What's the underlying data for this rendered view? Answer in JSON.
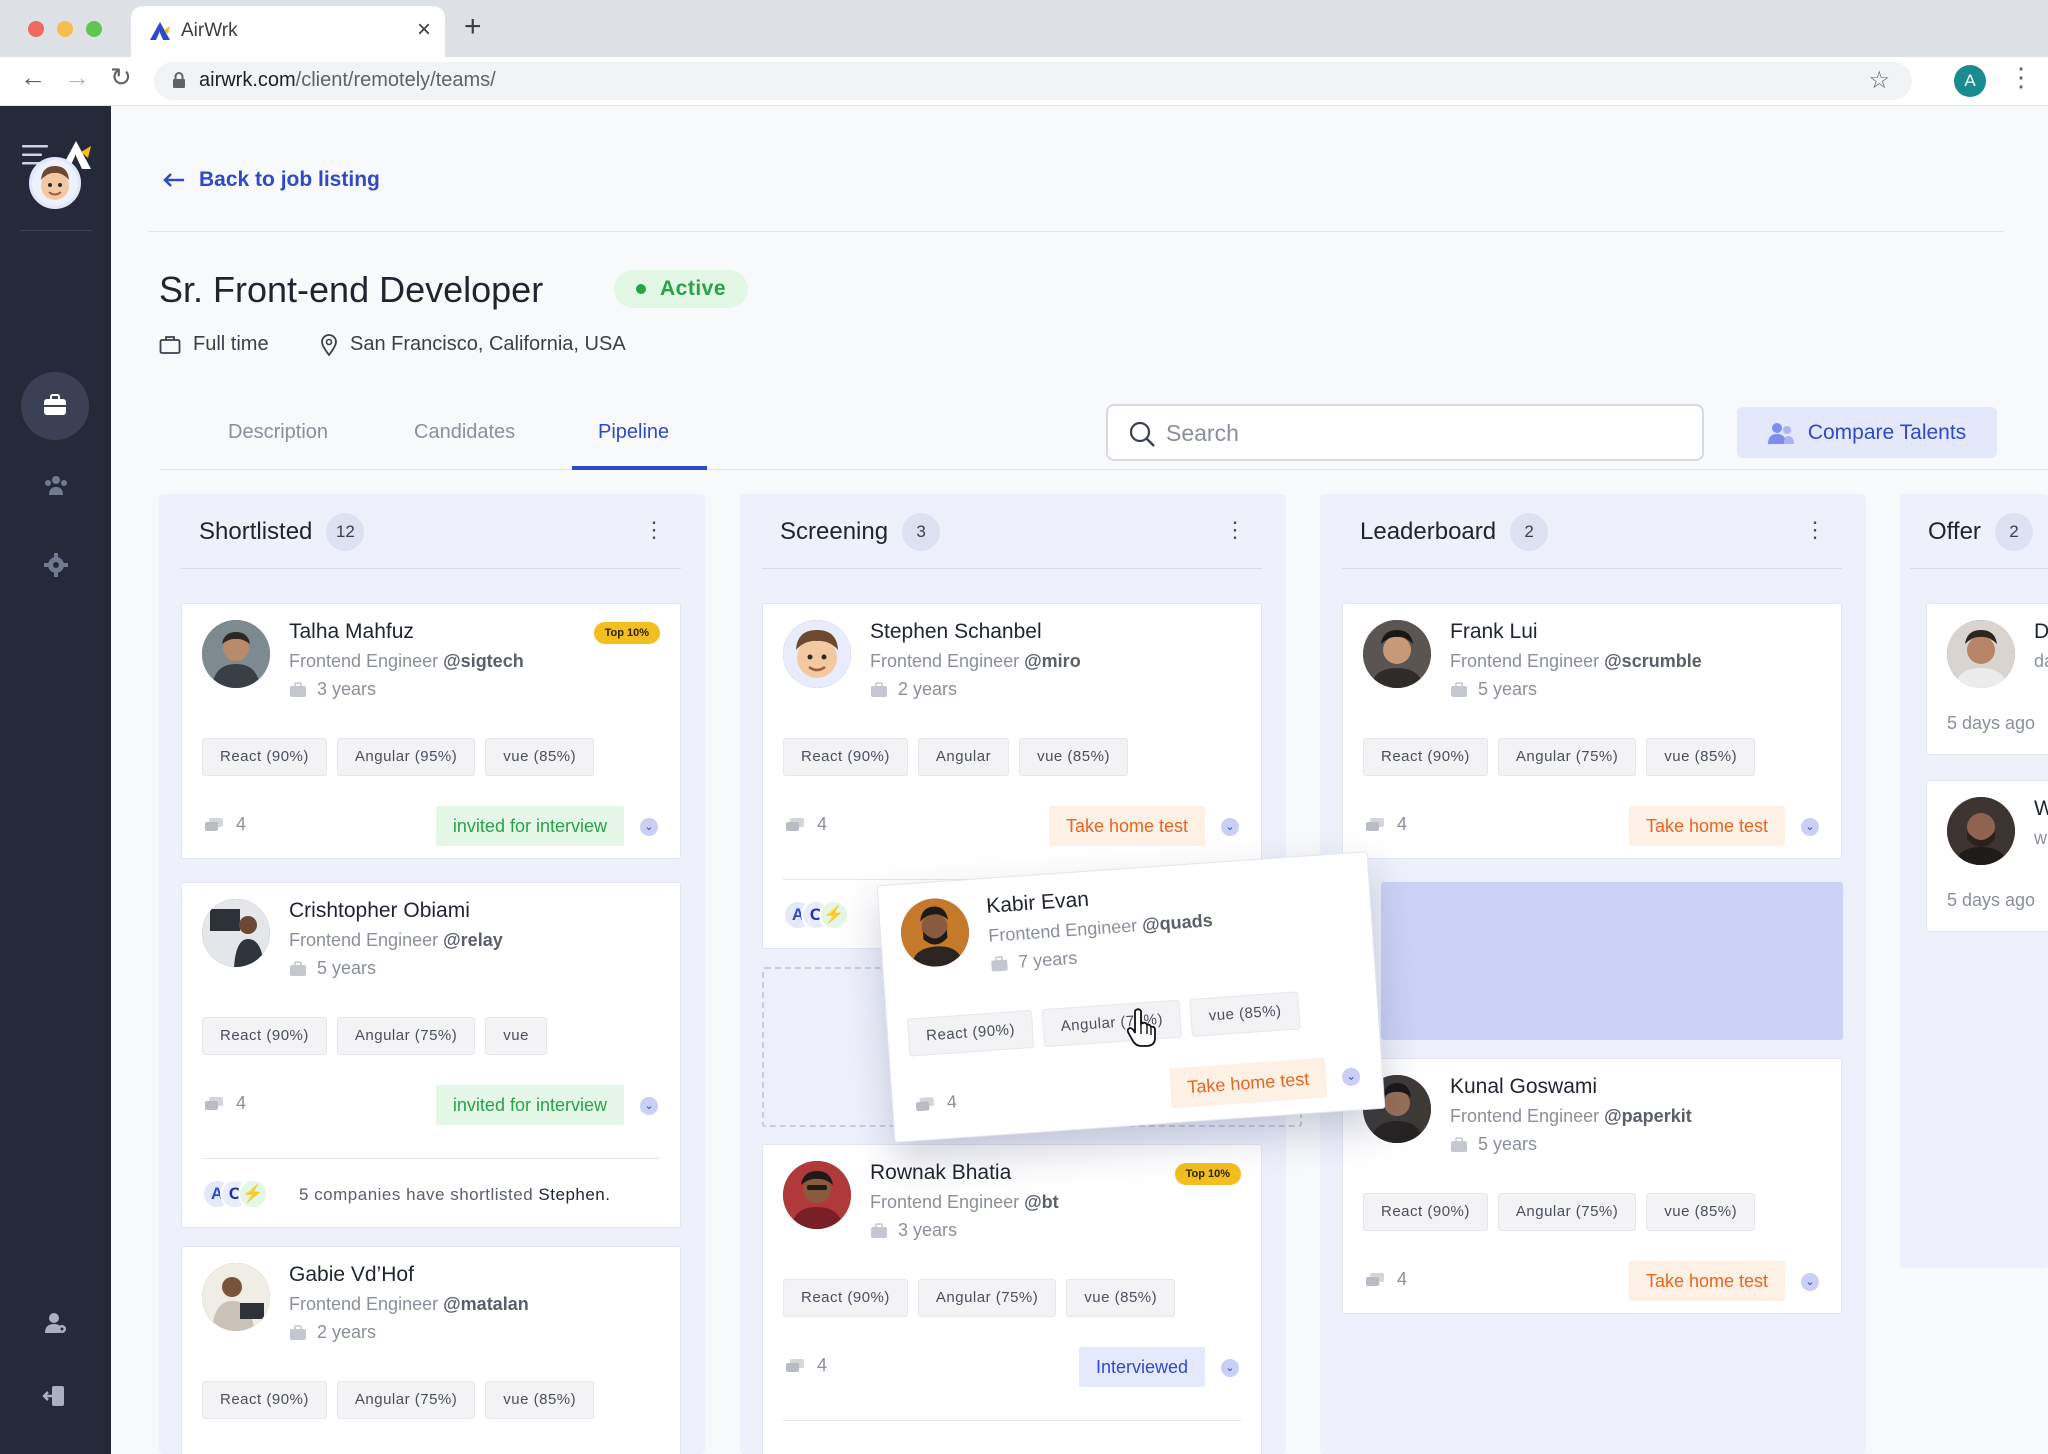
{
  "browser": {
    "tab_title": "AirWrk",
    "url_host": "airwrk.com",
    "url_path": "/client/remotely/teams/",
    "profile_initial": "A"
  },
  "page": {
    "back_label": "Back to job listing",
    "job_title": "Sr. Front-end Developer",
    "status": "Active",
    "employment_type": "Full time",
    "location": "San Francisco, California, USA"
  },
  "tabs": [
    {
      "label": "Description"
    },
    {
      "label": "Candidates"
    },
    {
      "label": "Pipeline",
      "active": true
    }
  ],
  "search": {
    "placeholder": "Search"
  },
  "compare_label": "Compare Talents",
  "columns": [
    {
      "name": "Shortlisted",
      "count": "12"
    },
    {
      "name": "Screening",
      "count": "3"
    },
    {
      "name": "Leaderboard",
      "count": "2"
    },
    {
      "name": "Offer",
      "count": "2"
    }
  ],
  "cards": {
    "talha": {
      "name": "Talha Mahfuz",
      "role": "Frontend Engineer",
      "company": "@sigtech",
      "years": "3 years",
      "badge": "Top 10%",
      "skills": [
        "React (90%)",
        "Angular (95%)",
        "vue (85%)"
      ],
      "comments": "4",
      "status": "invited for interview"
    },
    "crish": {
      "name": "Crishtopher Obiami",
      "role": "Frontend Engineer",
      "company": "@relay",
      "years": "5 years",
      "skills": [
        "React (90%)",
        "Angular (75%)",
        "vue"
      ],
      "comments": "4",
      "status": "invited for interview",
      "footer_text": "5 companies have shortlisted",
      "footer_name": "Stephen."
    },
    "gabie": {
      "name": "Gabie Vd’Hof",
      "role": "Frontend Engineer",
      "company": "@matalan",
      "years": "2 years",
      "skills": [
        "React (90%)",
        "Angular (75%)",
        "vue (85%)"
      ]
    },
    "stephen": {
      "name": "Stephen Schanbel",
      "role": "Frontend Engineer",
      "company": "@miro",
      "years": "2 years",
      "skills": [
        "React (90%)",
        "Angular",
        "vue (85%)"
      ],
      "comments": "4",
      "status": "Take home test"
    },
    "rownak": {
      "name": "Rownak Bhatia",
      "role": "Frontend Engineer",
      "company": "@bt",
      "years": "3 years",
      "badge": "Top 10%",
      "skills": [
        "React (90%)",
        "Angular (75%)",
        "vue (85%)"
      ],
      "comments": "4",
      "status": "Interviewed"
    },
    "kabir": {
      "name": "Kabir Evan",
      "role": "Frontend Engineer",
      "company": "@quads",
      "years": "7 years",
      "skills": [
        "React (90%)",
        "Angular (75%)",
        "vue (85%)"
      ],
      "comments": "4",
      "status": "Take home test"
    },
    "frank": {
      "name": "Frank Lui",
      "role": "Frontend Engineer",
      "company": "@scrumble",
      "years": "5 years",
      "skills": [
        "React (90%)",
        "Angular (75%)",
        "vue (85%)"
      ],
      "comments": "4",
      "status": "Take home test"
    },
    "kunal": {
      "name": "Kunal Goswami",
      "role": "Frontend Engineer",
      "company": "@paperkit",
      "years": "5 years",
      "skills": [
        "React (90%)",
        "Angular (75%)",
        "vue (85%)"
      ],
      "comments": "4",
      "status": "Take home test"
    },
    "offer1": {
      "initial": "D",
      "sub": "da",
      "time": "5 days ago"
    },
    "offer2": {
      "initial": "W",
      "sub": "w",
      "time": "5 days ago"
    }
  },
  "colors": {
    "accent": "#2f49c9",
    "sidebar": "#252a3b",
    "active_green": "#27a14a",
    "take_home_orange": "#e8641f",
    "top10_yellow": "#f2bf1e"
  },
  "icons": [
    "menu-icon",
    "airwrk-logo-icon",
    "briefcase-icon",
    "team-icon",
    "settings-icon",
    "user-settings-icon",
    "logout-icon",
    "search-icon",
    "compare-icon",
    "comment-icon",
    "chevron-down-icon",
    "location-pin-icon",
    "kebab-icon"
  ]
}
